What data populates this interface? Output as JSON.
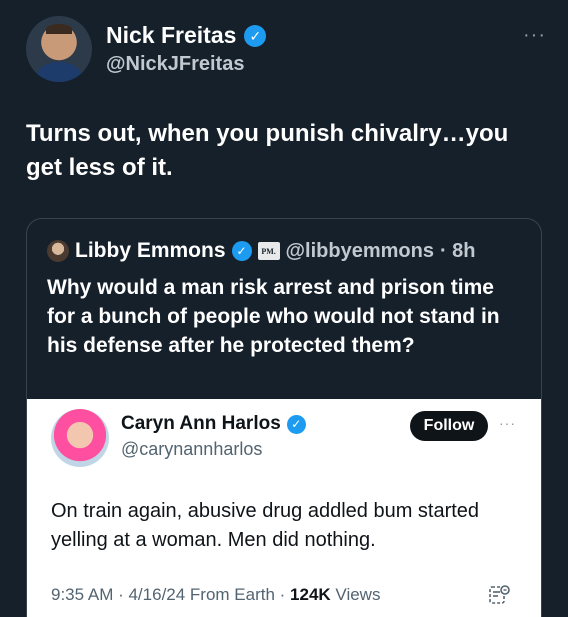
{
  "tweet": {
    "author_name": "Nick Freitas",
    "author_handle": "@NickJFreitas",
    "more_label": "···",
    "text": "Turns out, when you punish chivalry…you get less of it."
  },
  "quote": {
    "author_name": "Libby Emmons",
    "badge_label": "PM.",
    "author_handle": "@libbyemmons",
    "time": "· 8h",
    "text": "Why would a man risk arrest and prison time for a bunch of people who would not stand in his defense after he protected them?"
  },
  "embed": {
    "author_name": "Caryn Ann Harlos",
    "author_handle": "@carynannharlos",
    "follow_label": "Follow",
    "more_label": "···",
    "text": "On train again, abusive drug addled bum started yelling at a woman.  Men did nothing.",
    "meta_prefix": "9:35 AM · 4/16/24 From Earth · ",
    "views_count": "124K",
    "views_label": " Views"
  },
  "icons": {
    "verified": "verified-badge-icon",
    "grok": "grok-icon"
  },
  "colors": {
    "background": "#15202b",
    "verified_blue": "#1d9bf0",
    "embed_background": "#ffffff",
    "follow_button": "#0f1419"
  }
}
